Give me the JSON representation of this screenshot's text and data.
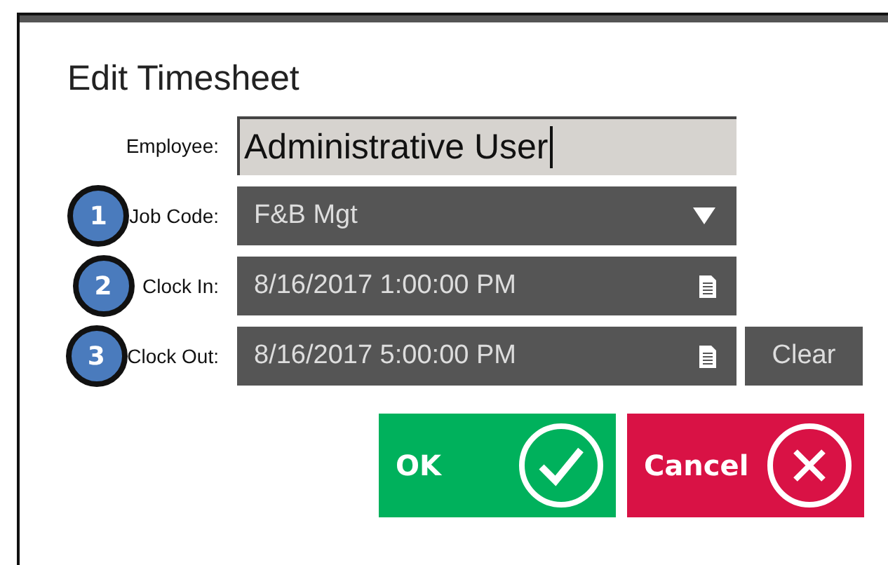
{
  "dialog": {
    "title": "Edit Timesheet"
  },
  "fields": [
    {
      "kind": "text",
      "label": "Employee:",
      "value": "Administrative User",
      "focused": true
    },
    {
      "kind": "dropdown",
      "label": "Job Code:",
      "value": "F&B Mgt",
      "badge": "1"
    },
    {
      "kind": "datetime",
      "label": "Clock In:",
      "value": "8/16/2017 1:00:00 PM",
      "badge": "2"
    },
    {
      "kind": "datetime",
      "label": "Clock Out:",
      "value": "8/16/2017 5:00:00 PM",
      "badge": "3",
      "clear": "Clear"
    }
  ],
  "buttons": [
    {
      "kind": "ok",
      "label": "OK"
    },
    {
      "kind": "cancel",
      "label": "Cancel"
    }
  ]
}
